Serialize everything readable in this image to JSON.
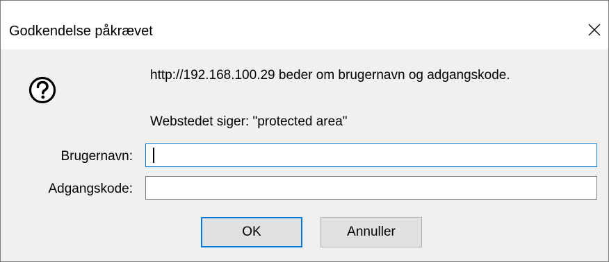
{
  "window": {
    "title": "Godkendelse påkrævet",
    "close_icon": "close-icon"
  },
  "message": {
    "icon": "question-icon",
    "line1": "http://192.168.100.29 beder om brugernavn og adgangskode.",
    "line2": "Webstedet siger: \"protected area\""
  },
  "form": {
    "username_label": "Brugernavn:",
    "username_value": "",
    "password_label": "Adgangskode:",
    "password_value": ""
  },
  "buttons": {
    "ok_label": "OK",
    "cancel_label": "Annuller"
  },
  "colors": {
    "focus_accent": "#0078d7",
    "dialog_background": "#f0f0f0",
    "titlebar_background": "#ffffff"
  }
}
